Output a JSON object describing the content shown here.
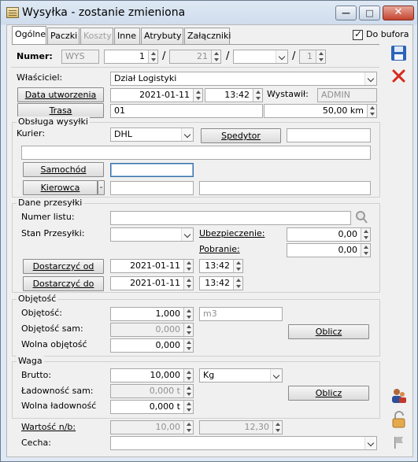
{
  "window": {
    "title": "Wysyłka - zostanie zmieniona"
  },
  "tabs": [
    {
      "label": "Ogólne"
    },
    {
      "label": "Paczki"
    },
    {
      "label": "Koszty"
    },
    {
      "label": "Inne"
    },
    {
      "label": "Atrybuty"
    },
    {
      "label": "Załączniki"
    }
  ],
  "to_buffer": {
    "label": "Do bufora",
    "checked": true
  },
  "numer": {
    "label": "Numer:",
    "prefix": "WYS",
    "seq": "1",
    "month": "21",
    "series": "",
    "suffix": "1"
  },
  "owner": {
    "label": "Właściciel:",
    "value": "Dział Logistyki"
  },
  "created": {
    "button": "Data utworzenia",
    "date": "2021-01-11",
    "time": "13:42",
    "issued_label": "Wystawił:",
    "issued_value": "ADMIN"
  },
  "route": {
    "button": "Trasa",
    "value": "01",
    "distance": "50,00 km"
  },
  "shipping_service": {
    "title": "Obsługa wysyłki",
    "courier_label": "Kurier:",
    "courier_value": "DHL",
    "forwarder_button": "Spedytor",
    "forwarder_value": "",
    "address_value": "",
    "vehicle_button": "Samochód",
    "vehicle_value": "",
    "driver_button": "Kierowca",
    "driver_dash": "-",
    "driver_value": "",
    "driver_extra": ""
  },
  "shipment_data": {
    "title": "Dane przesyłki",
    "tracking_label": "Numer listu:",
    "tracking_value": "",
    "status_label": "Stan Przesyłki:",
    "status_value": "",
    "insurance_label": "Ubezpieczenie:",
    "insurance_value": "0,00",
    "cod_label": "Pobranie:",
    "cod_value": "0,00",
    "deliver_from_button": "Dostarczyć od",
    "deliver_from_date": "2021-01-11",
    "deliver_from_time": "13:42",
    "deliver_to_button": "Dostarczyć do",
    "deliver_to_date": "2021-01-11",
    "deliver_to_time": "13:42"
  },
  "volume": {
    "title": "Objętość",
    "volume_label": "Objętość:",
    "volume_value": "1,000",
    "unit": "m3",
    "own_label": "Objętość sam:",
    "own_value": "0,000",
    "free_label": "Wolna objętość",
    "free_value": "0,000",
    "calc_button": "Oblicz"
  },
  "weight": {
    "title": "Waga",
    "gross_label": "Brutto:",
    "gross_value": "10,000",
    "unit": "Kg",
    "capacity_label": "Ładowność sam:",
    "capacity_value": "0,000 t",
    "free_label": "Wolna ładowność",
    "free_value": "0,000 t",
    "calc_button": "Oblicz"
  },
  "value_nb": {
    "label": "Wartość n/b:",
    "value1": "10,00",
    "value2": "12,30"
  },
  "feature": {
    "label": "Cecha:",
    "value": ""
  },
  "window_controls": {
    "min": "—",
    "max": "□",
    "close": "✕"
  },
  "colors": {
    "save_icon": "#2b63b8",
    "delete_icon": "#d62a1c"
  }
}
